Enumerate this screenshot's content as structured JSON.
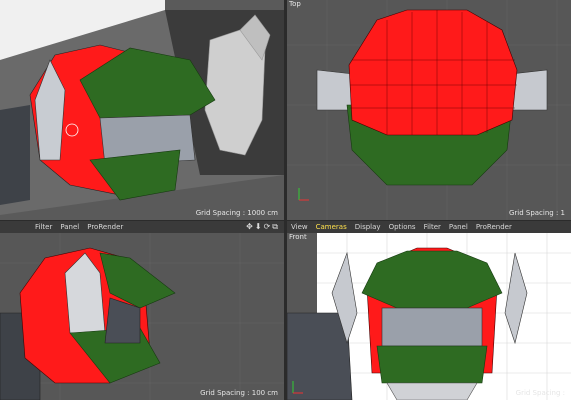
{
  "viewports": {
    "perspective": {
      "grid_spacing": "Grid Spacing : 1000 cm"
    },
    "top": {
      "label": "Top",
      "grid_spacing": "Grid Spacing : 1"
    },
    "right": {
      "menu": [
        "Filter",
        "Panel",
        "ProRender"
      ],
      "grid_spacing": "Grid Spacing : 100 cm",
      "nav_icons": "✥⬇⟳⧉"
    },
    "front": {
      "label": "Front",
      "menu": [
        "View",
        "Cameras",
        "Display",
        "Options",
        "Filter",
        "Panel",
        "ProRender"
      ],
      "grid_spacing": "Grid Spacing : "
    }
  },
  "colors": {
    "red": "#ff1a1a",
    "green": "#2e6b22",
    "gray_metal": "#b8bcc4",
    "dark_metal": "#4a4e56",
    "viewport_bg": "#555555"
  }
}
